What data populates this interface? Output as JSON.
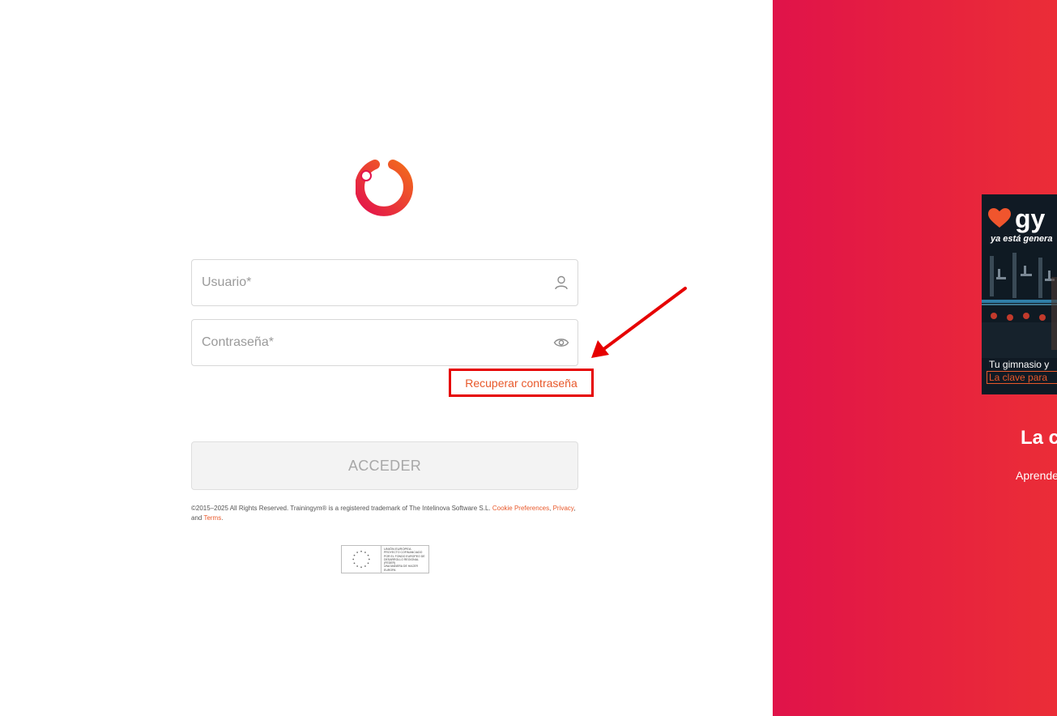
{
  "login": {
    "username_placeholder": "Usuario*",
    "password_placeholder": "Contraseña*",
    "recover_label": "Recuperar contraseña",
    "submit_label": "ACCEDER"
  },
  "icons": {
    "user": "user-icon",
    "password_toggle": "eye-icon",
    "logo": "trainingym-logo"
  },
  "footer": {
    "copyright": "©2015–2025 All Rights Reserved. Trainingym® is a registered trademark of The Intelinova Software S.L.",
    "cookie_label": "Cookie Preferences",
    "sep1": ",",
    "privacy_label": "Privacy",
    "sep2": ", and",
    "terms_label": "Terms",
    "end": "."
  },
  "eu_badge": {
    "line1": "UNIÓN EUROPEA",
    "line2": "PROYECTO COFINANCIADO POR EL FONDO EUROPEO DE DESARROLLO REGIONAL (FEDER)",
    "line3": "Una manera de hacer Europa"
  },
  "promo": {
    "brand": "gy",
    "tagline": "ya está genera",
    "caption_line1": "Tu gimnasio y",
    "caption_line2": "La clave para",
    "headline": "La c",
    "subline": "Aprende"
  },
  "colors": {
    "accent": "#e8582a",
    "panel_gradient_start": "#e0134a",
    "panel_gradient_end": "#eb2d37",
    "highlight_border": "#e60000"
  }
}
